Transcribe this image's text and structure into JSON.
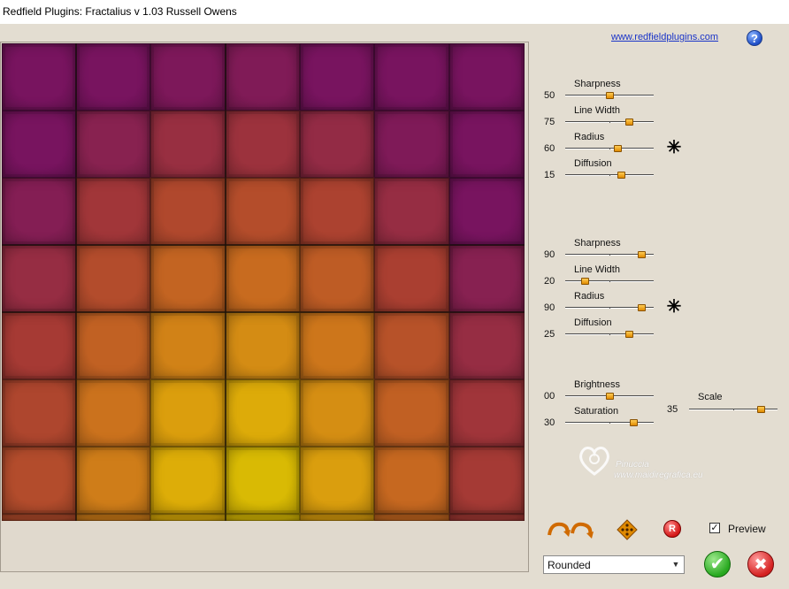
{
  "window": {
    "title": "Redfield Plugins: Fractalius v 1.03   Russell Owens"
  },
  "header": {
    "link_text": "www.redfieldplugins.com",
    "help_label": "?"
  },
  "groups": [
    {
      "sliders": [
        {
          "label": "Sharpness",
          "value": "50",
          "fraction": 0.5
        },
        {
          "label": "Line Width",
          "value": "75",
          "fraction": 0.75
        },
        {
          "label": "Radius",
          "value": "60",
          "fraction": 0.6
        },
        {
          "label": "Diffusion",
          "value": "15",
          "fraction": 0.65
        }
      ]
    },
    {
      "sliders": [
        {
          "label": "Sharpness",
          "value": "90",
          "fraction": 0.9
        },
        {
          "label": "Line Width",
          "value": "20",
          "fraction": 0.2
        },
        {
          "label": "Radius",
          "value": "90",
          "fraction": 0.9
        },
        {
          "label": "Diffusion",
          "value": "25",
          "fraction": 0.75
        }
      ]
    },
    {
      "sliders": [
        {
          "label": "Brightness",
          "value": "00",
          "fraction": 0.5
        },
        {
          "label": "Saturation",
          "value": "30",
          "fraction": 0.8
        }
      ]
    }
  ],
  "scale": {
    "label": "Scale",
    "value": "35",
    "fraction": 0.85
  },
  "randomize_icon": "✳",
  "watermark": {
    "name": "Pinuccia",
    "site": "www.maidiregrafica.eu"
  },
  "toolbar": {
    "undo_redo_icon": "arrows-icon",
    "move_icon": "move-icon",
    "reset_label": "R",
    "preview_checked": "✓",
    "preview_label": "Preview"
  },
  "style": {
    "selected": "Rounded",
    "arrow": "▼"
  },
  "actions": {
    "ok_symbol": "✔",
    "cancel_symbol": "✖"
  },
  "colors": {
    "accent_thumb": "#e08a00",
    "link": "#1a34c8",
    "ok": "#27a81f",
    "cancel": "#d42020"
  }
}
